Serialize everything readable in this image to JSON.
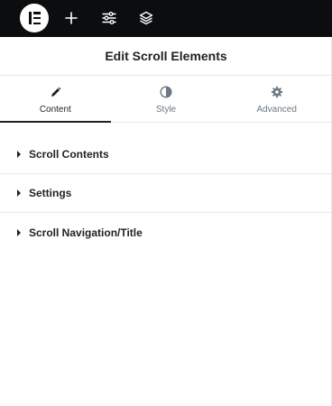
{
  "topbar": {
    "logo_icon": "elementor-logo-icon",
    "buttons": [
      {
        "icon": "plus-icon"
      },
      {
        "icon": "sliders-icon"
      },
      {
        "icon": "layers-icon"
      }
    ]
  },
  "header": {
    "title": "Edit Scroll Elements"
  },
  "tabs": [
    {
      "label": "Content",
      "icon": "pencil-icon",
      "active": true
    },
    {
      "label": "Style",
      "icon": "half-circle-icon",
      "active": false
    },
    {
      "label": "Advanced",
      "icon": "gear-icon",
      "active": false
    }
  ],
  "sections": [
    {
      "label": "Scroll Contents"
    },
    {
      "label": "Settings"
    },
    {
      "label": "Scroll Navigation/Title"
    }
  ],
  "colors": {
    "topbar_bg": "#0c0d0e",
    "text": "#1f2124",
    "muted": "#6d7882",
    "divider": "#e6e8ea"
  }
}
